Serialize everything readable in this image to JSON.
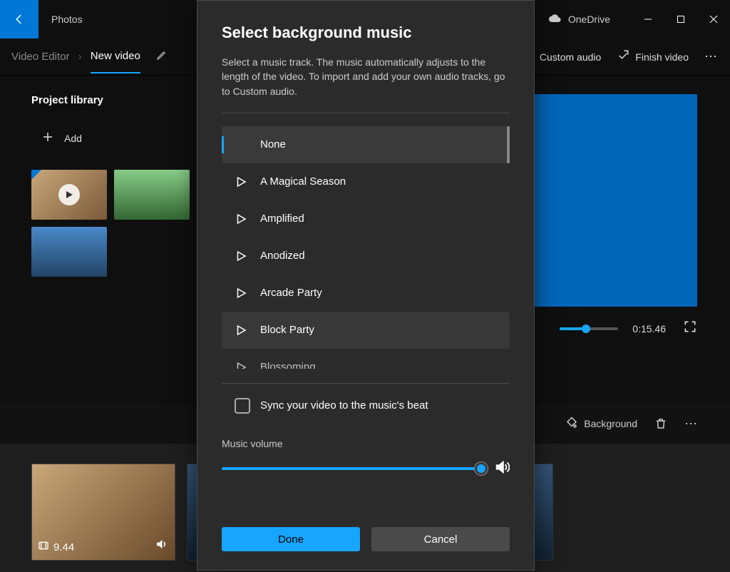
{
  "app": {
    "title": "Photos"
  },
  "titlebar": {
    "onedrive": "OneDrive"
  },
  "toolbar": {
    "breadcrumb": "Video Editor",
    "tab": "New video",
    "custom_audio": "Custom audio",
    "finish": "Finish video"
  },
  "library": {
    "heading": "Project library",
    "add": "Add"
  },
  "preview": {
    "timecode": "0:15.46"
  },
  "subtool": {
    "background": "Background"
  },
  "storyboard": {
    "clip_duration": "9.44"
  },
  "modal": {
    "title": "Select background music",
    "description": "Select a music track. The music automatically adjusts to the length of the video. To import and add your own audio tracks, go to Custom audio.",
    "tracks": {
      "0": "None",
      "1": "A Magical Season",
      "2": "Amplified",
      "3": "Anodized",
      "4": "Arcade Party",
      "5": "Block Party",
      "6": "Blossoming"
    },
    "sync": "Sync your video to the music's beat",
    "volume_label": "Music volume",
    "done": "Done",
    "cancel": "Cancel"
  }
}
